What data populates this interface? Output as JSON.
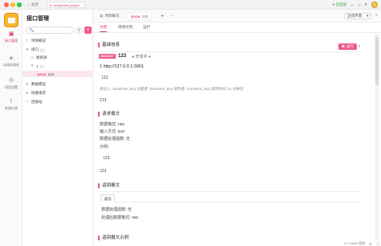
{
  "titlebar": {
    "home_label": "主页",
    "project_tab": "webpocket project",
    "status_ok": "已连接",
    "window_controls": [
      "minimize-icon",
      "maximize-icon",
      "close-icon"
    ]
  },
  "rail": {
    "items": [
      {
        "label": "接口管理",
        "icon": "api-icon",
        "active": true
      },
      {
        "label": "自动化测试",
        "icon": "test-icon",
        "active": false
      },
      {
        "label": "项目设置",
        "icon": "gear-icon",
        "active": false
      },
      {
        "label": "在线分享",
        "icon": "share-icon",
        "active": false
      }
    ]
  },
  "tree": {
    "title": "接口管理",
    "search_placeholder": "🔍",
    "nodes": [
      {
        "label": "项目概况",
        "icon": "□",
        "indent": 0
      },
      {
        "label": "接口",
        "icon": "▾",
        "indent": 0,
        "count": "(1)"
      },
      {
        "label": "根目录",
        "icon": "▸",
        "indent": 1
      },
      {
        "label": "1",
        "icon": "▾",
        "indent": 1,
        "count": "(1)"
      },
      {
        "label": "123",
        "method": "SOCK",
        "indent": 2,
        "selected": true
      },
      {
        "label": "数据模型",
        "icon": "▸",
        "indent": 0
      },
      {
        "label": "快捷请求",
        "icon": "▸",
        "indent": 0
      },
      {
        "label": "回收站",
        "icon": "□",
        "indent": 0
      }
    ]
  },
  "main": {
    "tabs": [
      {
        "label": "项目概况",
        "active": false
      },
      {
        "method": "SOCK",
        "label": "123",
        "active": true
      }
    ],
    "env_label": "正式环境",
    "subtabs": [
      "文档",
      "修改文档",
      "运行"
    ],
    "basic": {
      "title": "基础信息",
      "run_label": "运行",
      "method_badge": "SOCKET",
      "name": "123",
      "status": "开发中",
      "url": "1  http://127.0.0.1:3001",
      "desc": "123",
      "meta": "责任人: Sunshine_Boy    创建者: Sunshine_Boy    修改者: Sunshine_Boy    修改时间: 11 分钟前",
      "extra": "213"
    },
    "request": {
      "title": "请求报文",
      "format": "数据格式: raw",
      "input": "输入方式: text",
      "handler": "数据处理函数: 无",
      "example_label": "示例：",
      "example_value": "123",
      "extra": "123"
    },
    "response": {
      "title": "返回报文",
      "tab": "成功",
      "handler": "数据处理函数: 无",
      "format": "处理后数据格式: raw"
    },
    "response_example_title": "返回报文示例"
  },
  "footer": {
    "cookie": "Cookie 管理",
    "icons": [
      "settings-icon",
      "help-icon"
    ]
  },
  "colors": {
    "accent": "#f0598e",
    "sock": "#d9336e"
  }
}
